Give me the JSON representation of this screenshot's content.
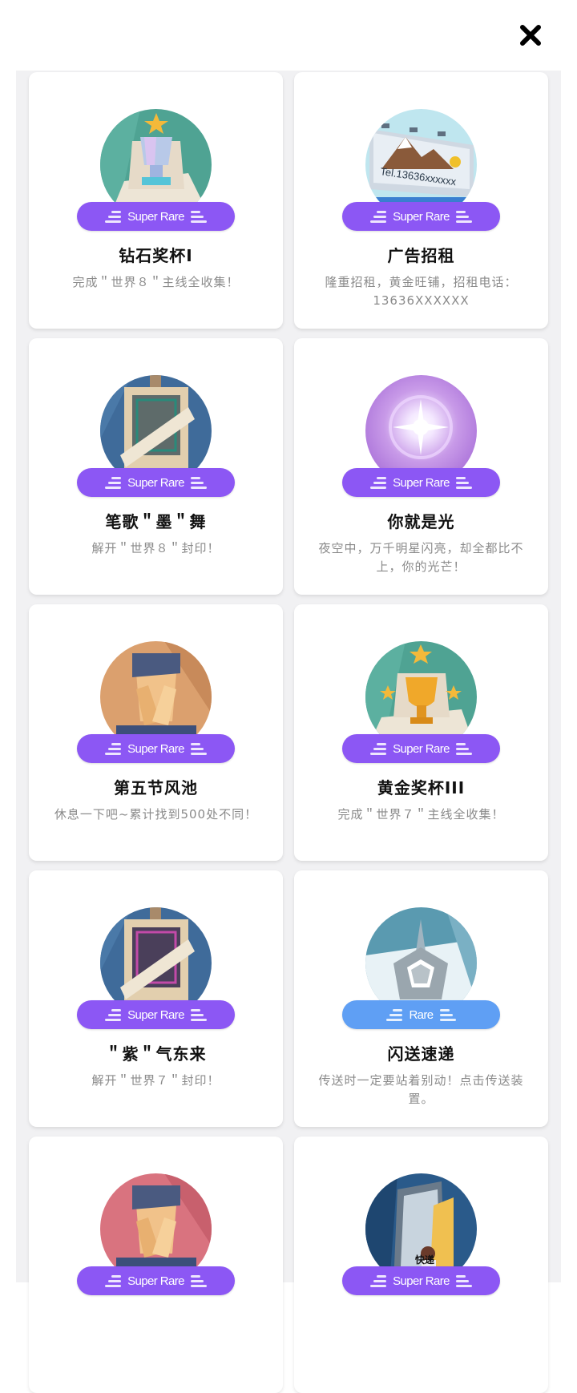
{
  "header": {
    "close_icon": "close-icon"
  },
  "accent_colors": {
    "super_rare": "#8c57f4",
    "rare": "#5f9ff4"
  },
  "cards": [
    {
      "title": "钻石奖杯I",
      "description": "完成＂世界８＂主线全收集！",
      "rarity": "Super Rare",
      "icon": "diamond-trophy-icon"
    },
    {
      "title": "广告招租",
      "description": "隆重招租，黄金旺铺，招租电话：13636XXXXXX",
      "rarity": "Super Rare",
      "icon": "billboard-icon",
      "art_text": "Tel.13636xxxxxx"
    },
    {
      "title": "笔歌＂墨＂舞",
      "description": "解开＂世界８＂封印！",
      "rarity": "Super Rare",
      "icon": "sealed-scroll-icon"
    },
    {
      "title": "你就是光",
      "description": "夜空中，万千明星闪亮，却全都比不上，你的光芒！",
      "rarity": "Super Rare",
      "icon": "sparkle-light-icon"
    },
    {
      "title": "第五节风池",
      "description": "休息一下吧~累计找到500处不同！",
      "rarity": "Super Rare",
      "icon": "eye-massage-icon"
    },
    {
      "title": "黄金奖杯III",
      "description": "完成＂世界７＂主线全收集！",
      "rarity": "Super Rare",
      "icon": "gold-trophy-icon"
    },
    {
      "title": "＂紫＂气东来",
      "description": "解开＂世界７＂封印！",
      "rarity": "Super Rare",
      "icon": "purple-scroll-icon"
    },
    {
      "title": "闪送速递",
      "description": "传送时一定要站着别动！点击传送装置。",
      "rarity": "Rare",
      "icon": "teleporter-icon"
    },
    {
      "title": "",
      "description": "",
      "rarity": "Super Rare",
      "icon": "eye-massage-pink-icon"
    },
    {
      "title": "",
      "description": "",
      "rarity": "Super Rare",
      "icon": "express-door-icon",
      "art_text": "快递"
    }
  ]
}
